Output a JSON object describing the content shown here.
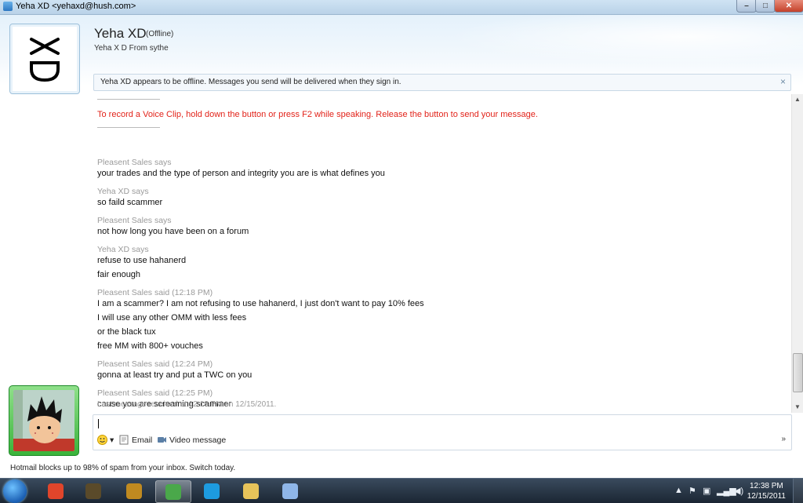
{
  "window": {
    "title": "Yeha XD <yehaxd@hush.com>",
    "buttons": {
      "minimize": "–",
      "maximize": "□",
      "close": "✕"
    }
  },
  "contact": {
    "name": "Yeha XD",
    "status": "(Offline)",
    "personal_message": "Yeha X D From sythe",
    "avatar_text": "XD"
  },
  "infobar": {
    "text": "Yeha XD appears to be offline. Messages you send will be delivered when they sign in.",
    "close": "×"
  },
  "conversation": {
    "voice_clip_note": "To record a Voice Clip, hold down the button or press F2 while speaking. Release the button to send your message.",
    "lines": [
      {
        "kind": "sender",
        "text": "Pleasent Sales says"
      },
      {
        "kind": "text",
        "text": "your trades and the type of person and integrity you are is what defines you"
      },
      {
        "kind": "sender",
        "text": "Yeha XD says"
      },
      {
        "kind": "text",
        "text": "so faild scammer"
      },
      {
        "kind": "sender",
        "text": "Pleasent Sales says"
      },
      {
        "kind": "text",
        "text": "not how long you have been on a forum"
      },
      {
        "kind": "sender",
        "text": "Yeha XD says"
      },
      {
        "kind": "text",
        "text": "refuse to use hahanerd"
      },
      {
        "kind": "text",
        "text": "fair enough"
      },
      {
        "kind": "sender",
        "text": "Pleasent Sales said (12:18 PM)"
      },
      {
        "kind": "text",
        "text": "I am a scammer? I am not refusing to use hahanerd, I just don't want to pay 10% fees"
      },
      {
        "kind": "text",
        "text": "I will use any other OMM with less fees"
      },
      {
        "kind": "text",
        "text": "or the black tux"
      },
      {
        "kind": "text",
        "text": "free MM with 800+ vouches"
      },
      {
        "kind": "sender",
        "text": "Pleasent Sales said (12:24 PM)"
      },
      {
        "kind": "text",
        "text": "gonna at least try and put a TWC on you"
      },
      {
        "kind": "sender",
        "text": "Pleasent Sales said (12:25 PM)"
      },
      {
        "kind": "text",
        "text": "cause you are screaming scammer"
      }
    ],
    "footer": "Last message received at 12:18 PM on 12/15/2011."
  },
  "input": {
    "value": "",
    "toolbar": {
      "emoticon": "emoticon-icon",
      "email_label": "Email",
      "video_label": "Video message",
      "more": "»"
    }
  },
  "ad": {
    "text": "Hotmail blocks up to 98% of spam from your inbox. Switch today."
  },
  "taskbar": {
    "apps": [
      {
        "name": "chrome",
        "color": "#e0452b",
        "active": false
      },
      {
        "name": "rs",
        "color": "#5a4a2a",
        "active": false
      },
      {
        "name": "wow",
        "color": "#c08a20",
        "active": false
      },
      {
        "name": "messenger",
        "color": "#4aa84a",
        "active": true
      },
      {
        "name": "skype",
        "color": "#1d9be0",
        "active": false
      },
      {
        "name": "explorer",
        "color": "#e7c35a",
        "active": false
      },
      {
        "name": "paint",
        "color": "#8fb6e8",
        "active": false
      }
    ],
    "time": "12:38 PM",
    "date": "12/15/2011"
  },
  "colors": {
    "voice_note": "#e2231a",
    "sender": "#9a9a9a",
    "own_frame": "#3ab33a"
  }
}
